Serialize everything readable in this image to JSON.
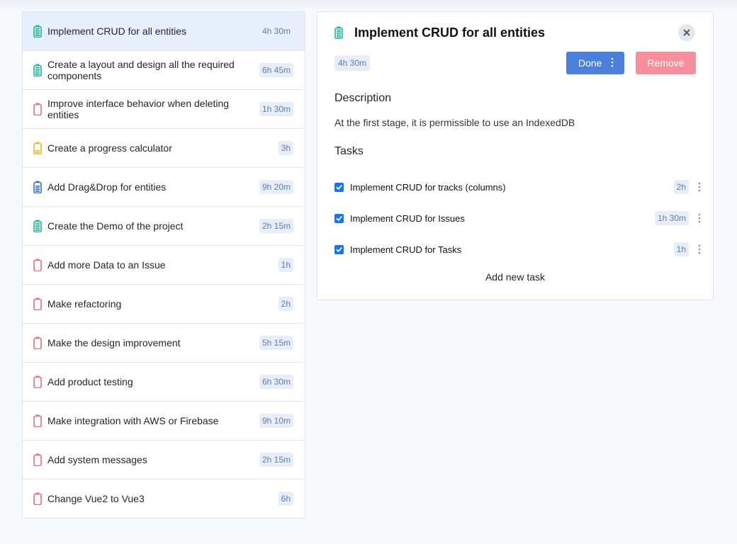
{
  "colors": {
    "green": "#22b59a",
    "red": "#ef6b7d",
    "yellow": "#f2b321",
    "blue": "#3c6ecf",
    "accent": "#4a7fdc",
    "danger": "#f68f9b"
  },
  "issues": [
    {
      "title": "Implement CRUD for all entities",
      "estimate": "4h 30m",
      "status": "green",
      "level": 1.0,
      "selected": true
    },
    {
      "title": "Create a layout and design all the required components",
      "estimate": "6h 45m",
      "status": "green",
      "level": 1.0
    },
    {
      "title": "Improve interface behavior when deleting entities",
      "estimate": "1h 30m",
      "status": "red",
      "level": 0.0
    },
    {
      "title": "Create a progress calculator",
      "estimate": "3h",
      "status": "yellow",
      "level": 0.3
    },
    {
      "title": "Add Drag&Drop for entities",
      "estimate": "9h 20m",
      "status": "blue",
      "level": 0.7
    },
    {
      "title": "Create the Demo of the project",
      "estimate": "2h 15m",
      "status": "green",
      "level": 1.0
    },
    {
      "title": "Add more Data to an Issue",
      "estimate": "1h",
      "status": "red",
      "level": 0.0
    },
    {
      "title": "Make refactoring",
      "estimate": "2h",
      "status": "red",
      "level": 0.0
    },
    {
      "title": "Make the design improvement",
      "estimate": "5h 15m",
      "status": "red",
      "level": 0.0
    },
    {
      "title": "Add product testing",
      "estimate": "6h 30m",
      "status": "red",
      "level": 0.0
    },
    {
      "title": "Make integration with AWS or Firebase",
      "estimate": "9h 10m",
      "status": "red",
      "level": 0.0
    },
    {
      "title": "Add system messages",
      "estimate": "2h 15m",
      "status": "red",
      "level": 0.0
    },
    {
      "title": "Change Vue2 to Vue3",
      "estimate": "6h",
      "status": "red",
      "level": 0.0
    }
  ],
  "detail": {
    "title": "Implement CRUD for all entities",
    "estimate": "4h 30m",
    "status": "green",
    "done_label": "Done",
    "remove_label": "Remove",
    "description_heading": "Description",
    "description": "At the first stage, it is permissible to use an IndexedDB",
    "tasks_heading": "Tasks",
    "tasks": [
      {
        "title": "Implement CRUD for tracks (columns)",
        "estimate": "2h",
        "checked": true
      },
      {
        "title": "Implement CRUD for Issues",
        "estimate": "1h 30m",
        "checked": true
      },
      {
        "title": "Implement CRUD for Tasks",
        "estimate": "1h",
        "checked": true
      }
    ],
    "add_task_label": "Add new task"
  }
}
